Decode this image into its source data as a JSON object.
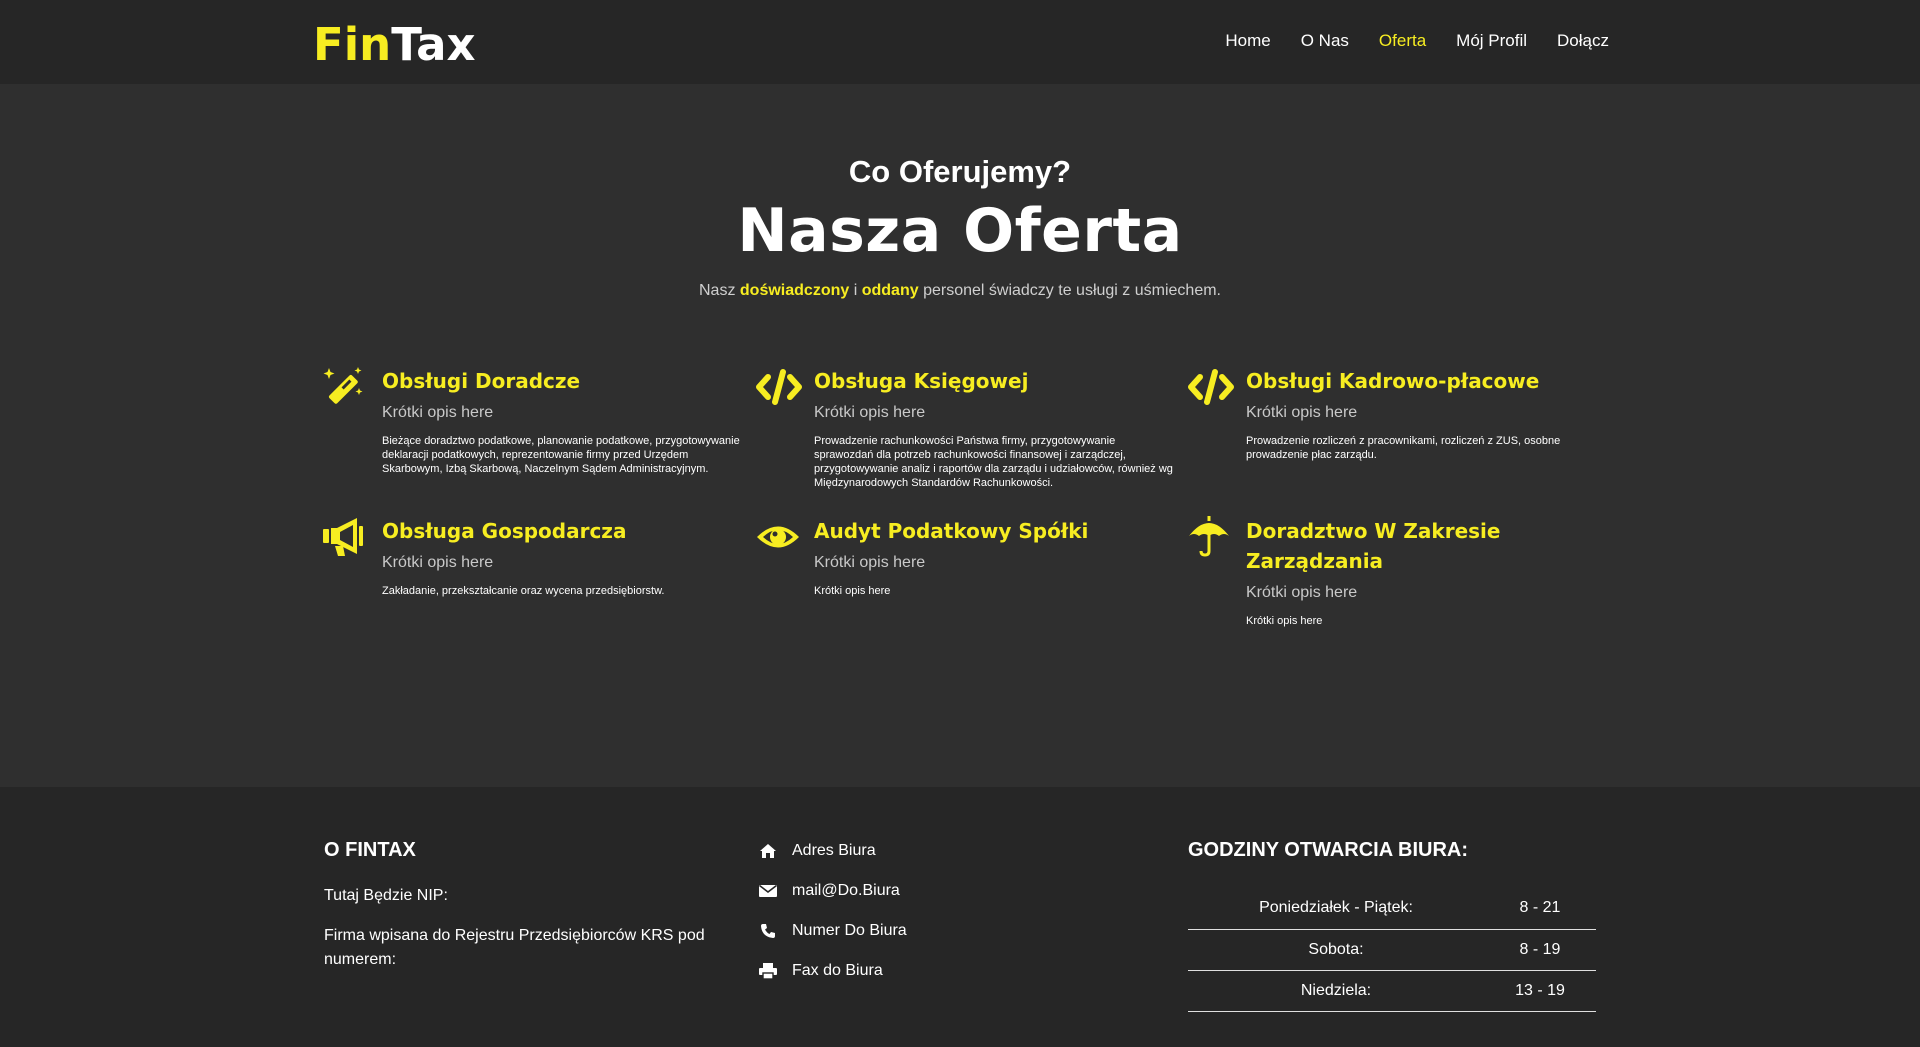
{
  "logo": {
    "part1": "Fin",
    "part2": "Tax"
  },
  "nav": [
    {
      "label": "Home",
      "active": false
    },
    {
      "label": "O Nas",
      "active": false
    },
    {
      "label": "Oferta",
      "active": true
    },
    {
      "label": "Mój Profil",
      "active": false
    },
    {
      "label": "Dołącz",
      "active": false
    }
  ],
  "intro": {
    "subtitle": "Co Oferujemy?",
    "title": "Nasza Oferta",
    "desc_pre": "Nasz",
    "desc_b1": "doświadczony",
    "desc_mid": "i",
    "desc_b2": "oddany",
    "desc_post": "personel świadczy te usługi z uśmiechem."
  },
  "services": [
    {
      "icon": "magic-wand-icon",
      "title": "Obsługi Doradcze",
      "short": "Krótki opis here",
      "long": "Bieżące doradztwo podatkowe, planowanie podatkowe, przygotowywanie deklaracji podatkowych, reprezentowanie firmy przed Urzędem Skarbowym, Izbą Skarbową, Naczelnym Sądem Administracyjnym."
    },
    {
      "icon": "code-icon",
      "title": "Obsługa Księgowej",
      "short": "Krótki opis here",
      "long": "Prowadzenie rachunkowości Państwa firmy, przygotowywanie sprawozdań dla potrzeb rachunkowości finansowej i zarządczej, przygotowywanie analiz i raportów dla zarządu i udziałowców, również wg Międzynarodowych Standardów Rachunkowości."
    },
    {
      "icon": "code-icon",
      "title": "Obsługi Kadrowo-płacowe",
      "short": "Krótki opis here",
      "long": "Prowadzenie rozliczeń z pracownikami, rozliczeń z ZUS, osobne prowadzenie płac zarządu."
    },
    {
      "icon": "megaphone-icon",
      "title": "Obsługa Gospodarcza",
      "short": "Krótki opis here",
      "long": "Zakładanie, przekształcanie oraz wycena przedsiębiorstw."
    },
    {
      "icon": "eye-icon",
      "title": "Audyt Podatkowy Spółki",
      "short": "Krótki opis here",
      "long": "Krótki opis here"
    },
    {
      "icon": "umbrella-icon",
      "title": "Doradztwo W Zakresie Zarządzania",
      "short": "Krótki opis here",
      "long": "Krótki opis here"
    }
  ],
  "footer": {
    "about_title": "O FINTAX",
    "nip": "Tutaj Będzie NIP:",
    "krs": "Firma wpisana do Rejestru Przedsiębiorców KRS pod numerem:",
    "contacts": [
      {
        "icon": "home-icon",
        "text": "Adres Biura"
      },
      {
        "icon": "envelope-icon",
        "text": "mail@Do.Biura"
      },
      {
        "icon": "phone-icon",
        "text": "Numer Do Biura"
      },
      {
        "icon": "printer-icon",
        "text": "Fax do Biura"
      }
    ],
    "hours_title": "GODZINY OTWARCIA BIURA:",
    "hours": [
      {
        "day": "Poniedziałek - Piątek:",
        "time": "8 - 21"
      },
      {
        "day": "Sobota:",
        "time": "8 - 19"
      },
      {
        "day": "Niedziela:",
        "time": "13 - 19"
      }
    ]
  },
  "colors": {
    "accent": "#f7ed21",
    "header_bg": "#262626",
    "main_bg": "#2f2f2f"
  }
}
